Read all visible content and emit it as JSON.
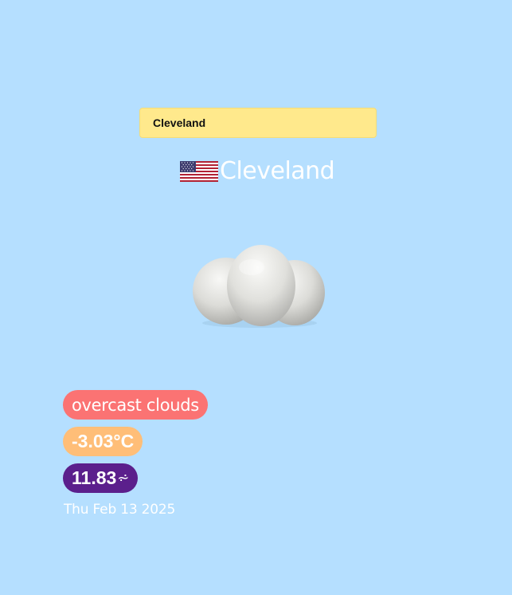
{
  "search": {
    "value": "Cleveland"
  },
  "location": {
    "country_flag": "us-flag",
    "city": "Cleveland"
  },
  "weather": {
    "icon": "cloud-icon",
    "description": "overcast clouds",
    "temperature": "-3.03°C",
    "wind_speed": "11.83",
    "wind_icon": "wind-icon",
    "wind_glyph": "⩫"
  },
  "date": "Thu Feb 13 2025",
  "colors": {
    "background": "#b5dfff",
    "search_bg": "#ffe98c",
    "description_pill": "#fb7373",
    "temperature_pill": "#ffbe78",
    "wind_pill": "#5b1f8c"
  }
}
